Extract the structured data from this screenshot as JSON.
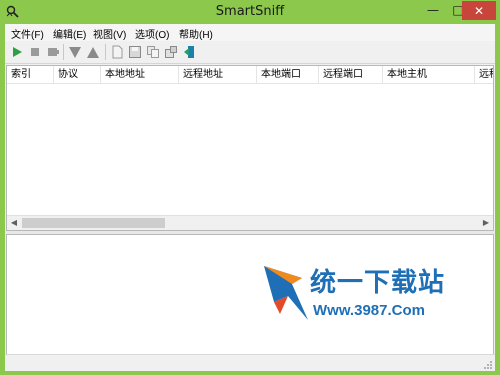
{
  "window": {
    "title": "SmartSniff",
    "minimize": "—",
    "maximize": "□",
    "close": "✕"
  },
  "menu": [
    {
      "label": "文件(F)"
    },
    {
      "label": "编辑(E)"
    },
    {
      "label": "视图(V)"
    },
    {
      "label": "选项(O)"
    },
    {
      "label": "帮助(H)"
    }
  ],
  "toolbar": {
    "icons": [
      "play-icon",
      "stop-icon",
      "stop-record-icon",
      "filter-down-icon",
      "filter-up-icon",
      "new-doc-icon",
      "save-icon",
      "copy-icon",
      "properties-icon",
      "exit-icon"
    ]
  },
  "table": {
    "columns": [
      "索引",
      "协议",
      "本地地址",
      "远程地址",
      "本地端口",
      "远程端口",
      "本地主机",
      "远程"
    ],
    "rows": []
  },
  "watermark": {
    "cn": "统一下载站",
    "en": "Www.3987.Com"
  },
  "colors": {
    "frame": "#8cc84b",
    "close": "#c7453a",
    "watermark": "#1f6fb6"
  }
}
